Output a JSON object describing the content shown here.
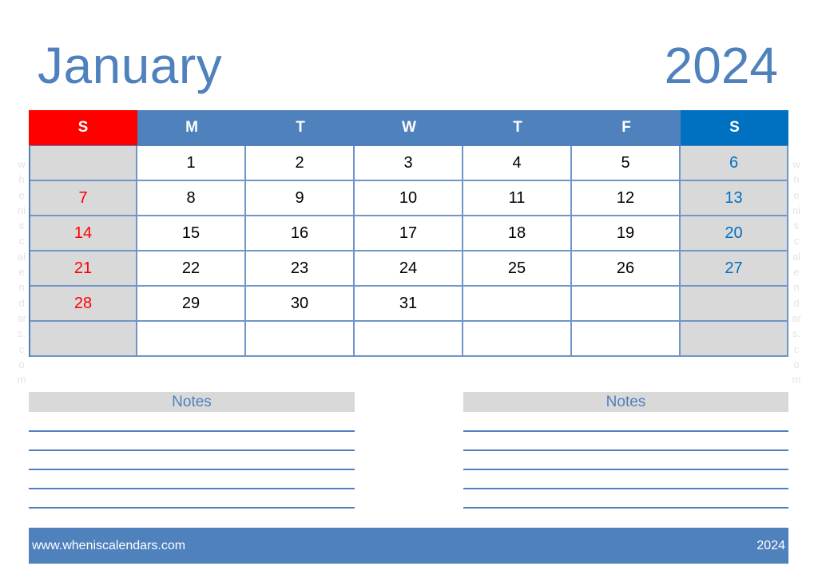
{
  "header": {
    "month": "January",
    "year": "2024"
  },
  "colors": {
    "accent": "#4f81bd",
    "sunday_header": "#ff0000",
    "saturday_header": "#0070c0",
    "weekend_cell": "#d9d9d9",
    "sunday_text": "#ff0000",
    "saturday_text": "#0070c0"
  },
  "calendar": {
    "weekdays": [
      "S",
      "M",
      "T",
      "W",
      "T",
      "F",
      "S"
    ],
    "weeks": [
      [
        "",
        "1",
        "2",
        "3",
        "4",
        "5",
        "6"
      ],
      [
        "7",
        "8",
        "9",
        "10",
        "11",
        "12",
        "13"
      ],
      [
        "14",
        "15",
        "16",
        "17",
        "18",
        "19",
        "20"
      ],
      [
        "21",
        "22",
        "23",
        "24",
        "25",
        "26",
        "27"
      ],
      [
        "28",
        "29",
        "30",
        "31",
        "",
        "",
        ""
      ],
      [
        "",
        "",
        "",
        "",
        "",
        "",
        ""
      ]
    ]
  },
  "notes": {
    "left_title": "Notes",
    "right_title": "Notes",
    "line_count": 5
  },
  "watermark": {
    "letters": [
      "w",
      "h",
      "e",
      "ni",
      "s",
      "c",
      "al",
      "e",
      "n",
      "d",
      "ar",
      "s.",
      "c",
      "o",
      "m"
    ]
  },
  "footer": {
    "website": "www.wheniscalendars.com",
    "year": "2024"
  }
}
